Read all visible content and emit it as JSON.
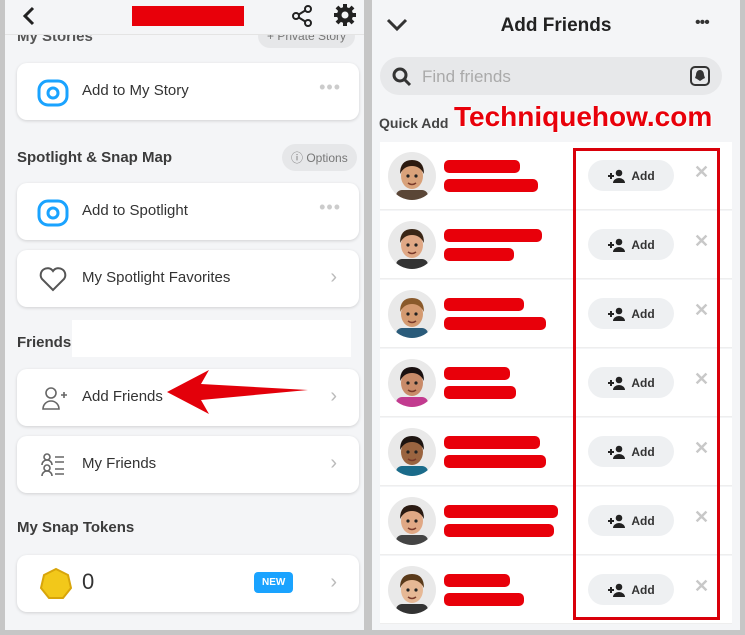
{
  "left": {
    "sections": {
      "my_stories": "My Stories",
      "spotlight": "Spotlight & Snap Map",
      "friends": "Friends",
      "tokens": "My Snap Tokens"
    },
    "private_story": "+ Private Story",
    "options": "Options",
    "items": {
      "add_story": "Add to My Story",
      "add_spotlight": "Add to Spotlight",
      "spotlight_favs": "My Spotlight Favorites",
      "add_friends": "Add Friends",
      "my_friends": "My Friends"
    },
    "token_count": "0",
    "new_badge": "NEW"
  },
  "right": {
    "title": "Add Friends",
    "search_placeholder": "Find friends",
    "quick_add": "Quick Add",
    "watermark": "Techniquehow.com",
    "add_label": "Add",
    "rows": [
      {
        "hair": "#2b1a10",
        "skin": "#d9a27a",
        "shirt": "#5a4636",
        "n1": 76,
        "n2": 94
      },
      {
        "hair": "#3a2616",
        "skin": "#e0a885",
        "shirt": "#333",
        "n1": 98,
        "n2": 70
      },
      {
        "hair": "#8a5a2b",
        "skin": "#d49a70",
        "shirt": "#2a5b7a",
        "n1": 80,
        "n2": 102
      },
      {
        "hair": "#1a1010",
        "skin": "#c98b69",
        "shirt": "#c23b8f",
        "n1": 66,
        "n2": 72
      },
      {
        "hair": "#1d1410",
        "skin": "#9a6440",
        "shirt": "#1a6b8a",
        "n1": 96,
        "n2": 102
      },
      {
        "hair": "#2a1a12",
        "skin": "#e0a885",
        "shirt": "#444",
        "n1": 114,
        "n2": 110
      },
      {
        "hair": "#5a3a1a",
        "skin": "#e6b895",
        "shirt": "#333",
        "n1": 66,
        "n2": 80
      }
    ]
  },
  "colors": {
    "accent_red": "#e8000a",
    "snap_blue": "#1aa3ff"
  }
}
